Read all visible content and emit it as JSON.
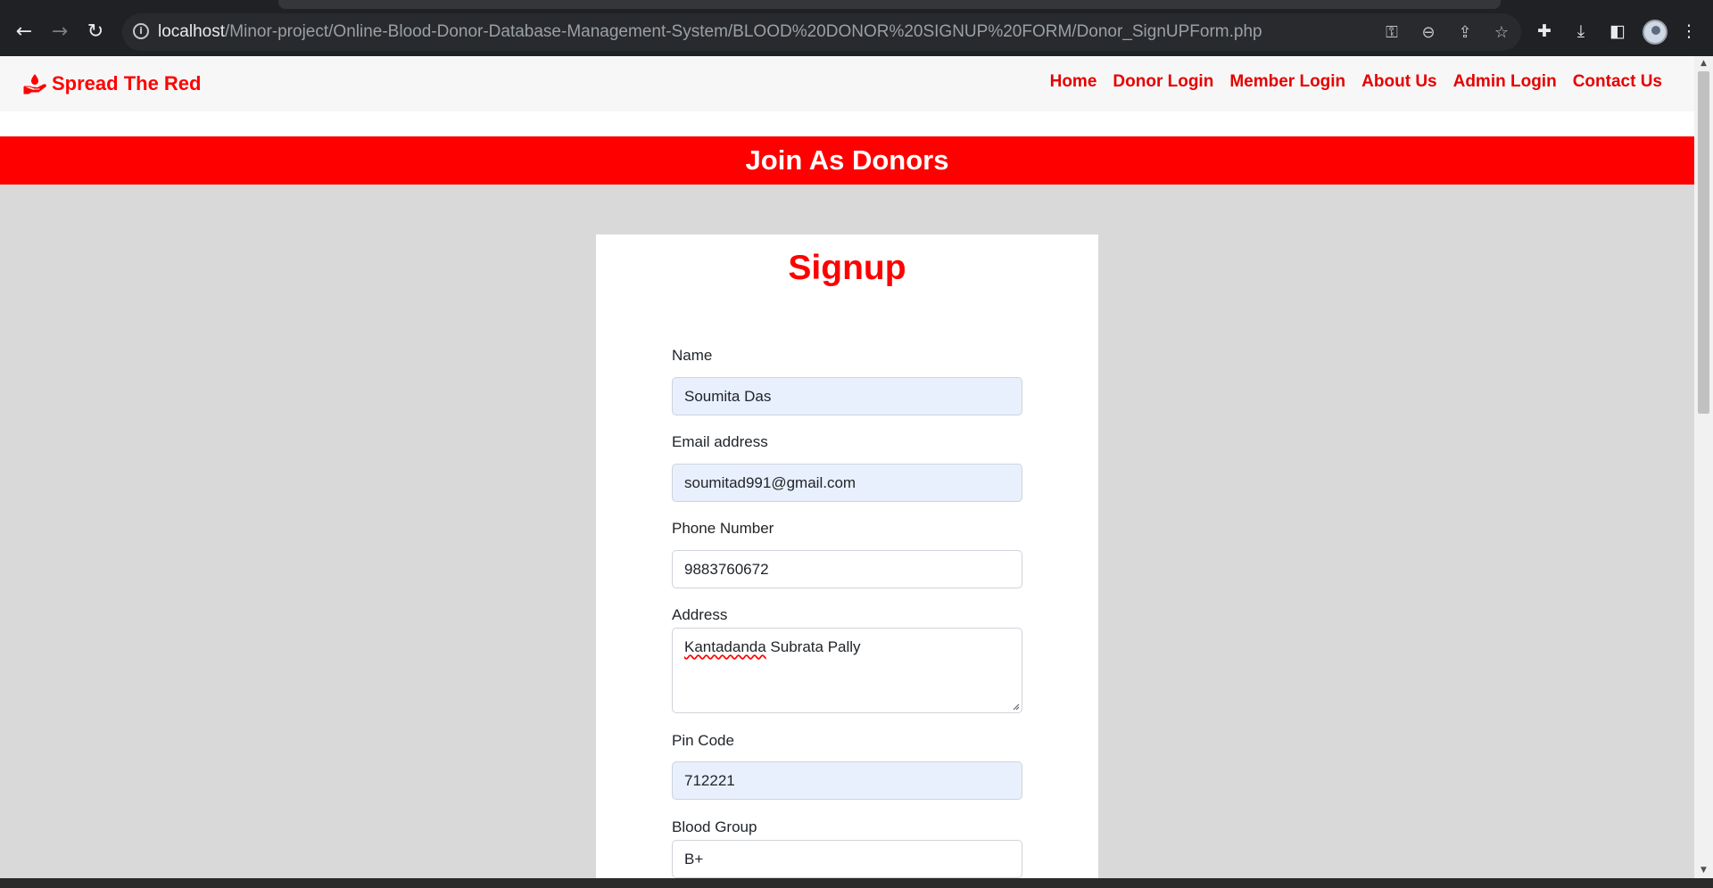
{
  "browser": {
    "url_host": "localhost",
    "url_path": "/Minor-project/Online-Blood-Donor-Database-Management-System/BLOOD%20DONOR%20SIGNUP%20FORM/Donor_SignUPForm.php",
    "icons": [
      "back-arrow-icon",
      "forward-arrow-icon",
      "reload-icon",
      "site-info-icon",
      "key-icon",
      "zoom-out-icon",
      "share-icon",
      "star-icon",
      "puzzle-extensions-icon",
      "download-icon",
      "side-panel-icon",
      "profile-avatar",
      "kebab-menu-icon"
    ]
  },
  "navbar": {
    "brand": "Spread The Red",
    "links": [
      "Home",
      "Donor Login",
      "Member Login",
      "About Us",
      "Admin Login",
      "Contact Us"
    ]
  },
  "banner": {
    "title": "Join As Donors"
  },
  "form": {
    "title": "Signup",
    "name": {
      "label": "Name",
      "value": "Soumita Das"
    },
    "email": {
      "label": "Email address",
      "value": "soumitad991@gmail.com"
    },
    "phone": {
      "label": "Phone Number",
      "value": "9883760672"
    },
    "address": {
      "label": "Address",
      "value_word1": "Kantadanda",
      "value_rest": " Subrata Pally"
    },
    "pincode": {
      "label": "Pin Code",
      "value": "712221"
    },
    "blood_group": {
      "label": "Blood Group",
      "value": "B+"
    }
  },
  "colors": {
    "brand_red": "#ff0000",
    "autofill_bg": "#e8f0fe",
    "page_bg": "#d9d9d9"
  }
}
